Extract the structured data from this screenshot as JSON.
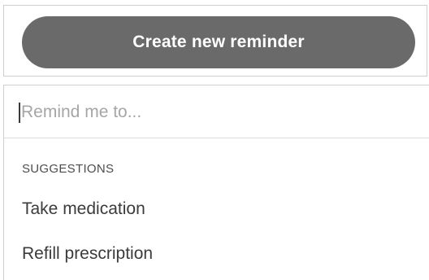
{
  "create": {
    "button_label": "Create new reminder"
  },
  "reminder_input": {
    "placeholder": "Remind me to...",
    "value": ""
  },
  "suggestions": {
    "heading": "SUGGESTIONS",
    "items": [
      {
        "label": "Take medication"
      },
      {
        "label": "Refill prescription"
      }
    ]
  },
  "colors": {
    "button_background": "#6a6a6a",
    "button_text": "#ffffff",
    "placeholder_text": "#a6a6a6",
    "body_text": "#3b3b3b",
    "border": "#cfcfcf"
  }
}
